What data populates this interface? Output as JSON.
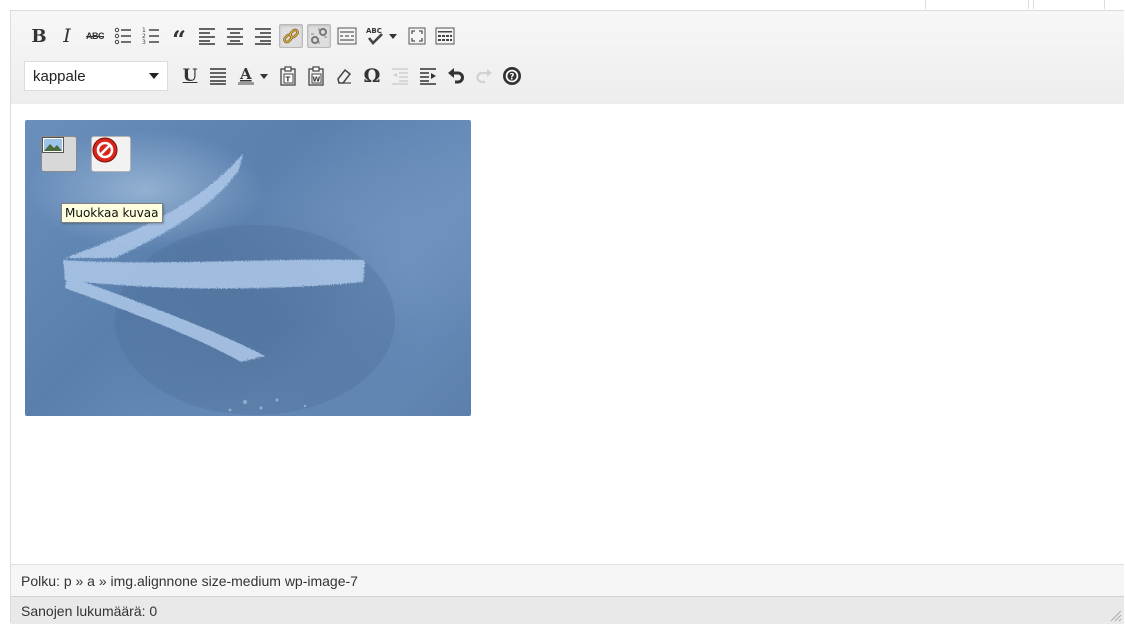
{
  "toolbar": {
    "row1": [
      {
        "name": "bold-button",
        "glyph": "B",
        "cls": "bold"
      },
      {
        "name": "italic-button",
        "glyph": "I",
        "cls": "ital"
      },
      {
        "name": "strikethrough-button",
        "glyph": "ABC",
        "cls": "small"
      }
    ],
    "format_select": {
      "value": "kappale"
    },
    "underline_glyph": "U",
    "omega_glyph": "Ω",
    "quote_glyph": "“",
    "bold_glyph": "B",
    "italic_glyph": "I",
    "strike_glyph": "ABC",
    "spell_glyph": "ABC"
  },
  "image_overlay": {
    "tooltip": "Muokkaa kuvaa"
  },
  "path_bar": {
    "prefix": "Polku: ",
    "path": "p » a » img.alignnone size-medium wp-image-7"
  },
  "status_bar": {
    "word_count": "Sanojen lukumäärä: 0"
  },
  "colors": {
    "toolbar_bg": "#ededed",
    "tooltip_bg": "#ffffe0",
    "delete_red": "#d9261c"
  }
}
